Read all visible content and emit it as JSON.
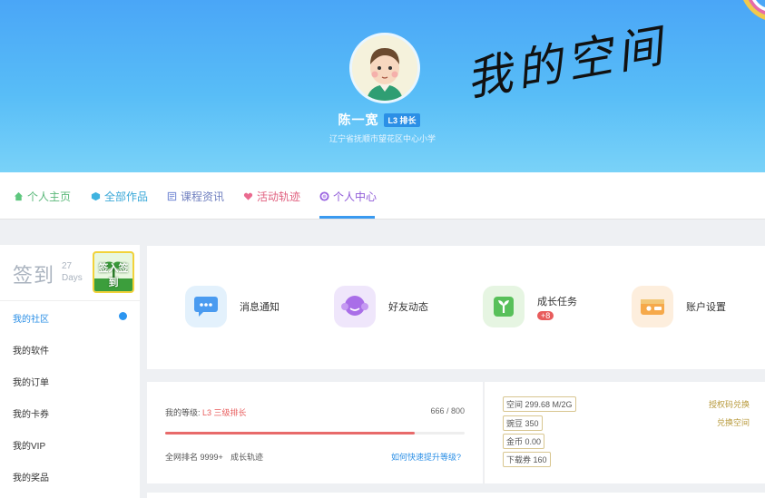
{
  "header": {
    "user_name": "陈一宽",
    "level_badge": "L3 排长",
    "school": "辽宁省抚顺市望花区中心小学",
    "space_title": "我的空间"
  },
  "nav": {
    "items": [
      {
        "label": "个人主页",
        "icon": "home-icon",
        "color": "#5ec77e"
      },
      {
        "label": "全部作品",
        "icon": "cube-icon",
        "color": "#3fb3e0"
      },
      {
        "label": "课程资讯",
        "icon": "book-icon",
        "color": "#7b8fd6"
      },
      {
        "label": "活动轨迹",
        "icon": "heart-icon",
        "color": "#ea6a8f"
      },
      {
        "label": "个人中心",
        "icon": "ring-icon",
        "color": "#9a63e0",
        "active": true
      }
    ]
  },
  "sidebar": {
    "sign_title": "签到",
    "sign_days": "27",
    "sign_unit": "Days",
    "sign_button": "签入签到",
    "items": [
      {
        "label": "我的社区",
        "active": true
      },
      {
        "label": "我的软件"
      },
      {
        "label": "我的订单"
      },
      {
        "label": "我的卡券"
      },
      {
        "label": "我的VIP"
      },
      {
        "label": "我的奖品"
      }
    ]
  },
  "quick_actions": [
    {
      "label": "消息通知",
      "icon": "chat-bubble-icon",
      "bg": "#e3f1fc"
    },
    {
      "label": "好友动态",
      "icon": "friend-face-icon",
      "bg": "#efe6fb"
    },
    {
      "label": "成长任务",
      "icon": "sprout-icon",
      "bg": "#e6f5e2",
      "badge": "+8"
    },
    {
      "label": "账户设置",
      "icon": "wallet-icon",
      "bg": "#fdeedd"
    }
  ],
  "level": {
    "label_prefix": "我的等级:",
    "label_level": "L3 三级排长",
    "score": "666 / 800",
    "progress": 0.8325,
    "rank": "全网排名 9999+",
    "track_link": "成长轨迹",
    "help_link": "如何快速提升等级?"
  },
  "assets": {
    "tags": [
      "空间 299.68 M/2G",
      "豌豆 350",
      "金币 0.00",
      "下载券 160"
    ],
    "links": [
      "授权码兑换",
      "兑换空间"
    ]
  }
}
